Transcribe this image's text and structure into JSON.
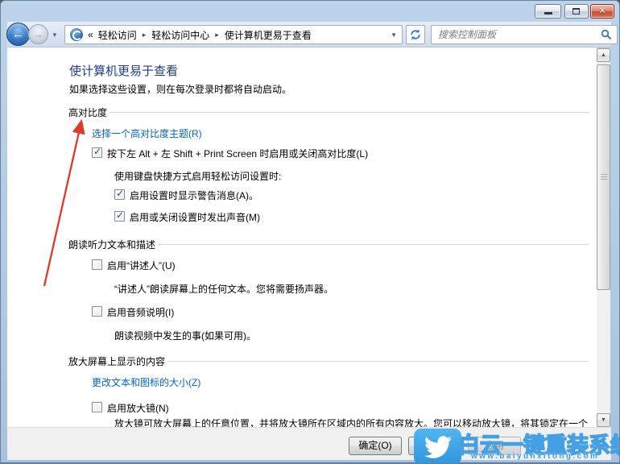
{
  "toolbar": {
    "breadcrumb": {
      "prefix": "«",
      "separator": "▸",
      "items": [
        "轻松访问",
        "轻松访问中心",
        "使计算机更易于查看"
      ]
    },
    "search_placeholder": "搜索控制面板"
  },
  "icons": {
    "back": "←",
    "forward": "→",
    "history_dropdown": "▼",
    "address_dropdown": "▼",
    "close": "✕",
    "scroll_up": "▲",
    "scroll_down": "▼"
  },
  "page": {
    "title": "使计算机更易于查看",
    "subtitle": "如果选择这些设置，则在每次登录时都将自动启动。",
    "sections": {
      "high_contrast": {
        "title": "高对比度",
        "theme_link": "选择一个高对比度主题(R)",
        "toggle_checkbox": {
          "label": "按下左 Alt + 左 Shift + Print Screen 时启用或关闭高对比度(L)",
          "checked": true
        },
        "shortcut_note": "使用键盘快捷方式启用轻松访问设置时:",
        "warning_checkbox": {
          "label": "启用设置时显示警告消息(A)。",
          "checked": true
        },
        "sound_checkbox": {
          "label": "启用或关闭设置时发出声音(M)",
          "checked": true
        }
      },
      "narration": {
        "title": "朗读听力文本和描述",
        "narrator_checkbox": {
          "label": "启用“讲述人”(U)",
          "checked": false
        },
        "narrator_desc": "“讲述人”朗读屏幕上的任何文本。您将需要扬声器。",
        "audio_checkbox": {
          "label": "启用音频说明(I)",
          "checked": false
        },
        "audio_desc": "朗读视频中发生的事(如果可用)。"
      },
      "magnify": {
        "title": "放大屏幕上显示的内容",
        "resize_link": "更改文本和图标的大小(Z)",
        "magnifier_checkbox": {
          "label": "启用放大镜(N)",
          "checked": false
        },
        "magnifier_desc": "放大镜可放大屏幕上的任意位置，并将放大镜所在区域内的所有内容放大。您可以移动放大镜，将其锁定在一个位置或调整其大小。"
      }
    }
  },
  "footer": {
    "ok_label": "确定(O)",
    "cancel_label": "取消",
    "apply_label": "应用"
  },
  "watermark": {
    "brand": "白云一键重装系统",
    "url": "www.baiyunxitong.com"
  },
  "colors": {
    "heading_blue": "#1e3c91",
    "link_blue": "#0066cc",
    "watermark_blue": "#3f9be0",
    "arrow_red": "#e0392b",
    "close_red": "#c74c31"
  }
}
